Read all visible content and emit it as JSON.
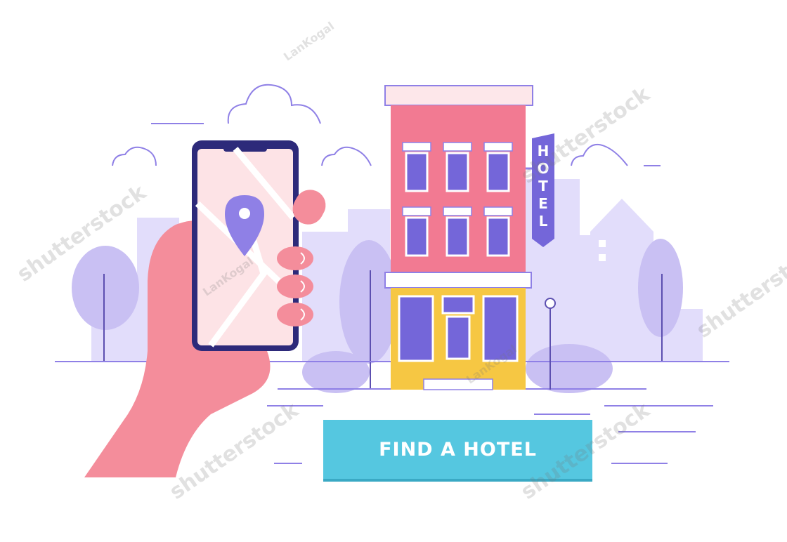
{
  "sign": {
    "letters": [
      "H",
      "O",
      "T",
      "E",
      "L"
    ]
  },
  "cta": {
    "label": "FIND A HOTEL"
  },
  "watermarks": {
    "stock": "shutterstock",
    "author": "LanKogal"
  },
  "colors": {
    "button": "#55c7e0",
    "building": "#f27a92",
    "ground_floor": "#f6c743",
    "lavender": "#c9c0f3",
    "purple": "#8f80e6",
    "hand": "#f48d9b"
  },
  "icons": [
    "map-pin-icon",
    "cloud-icon",
    "tree-icon",
    "street-lamp-icon"
  ]
}
